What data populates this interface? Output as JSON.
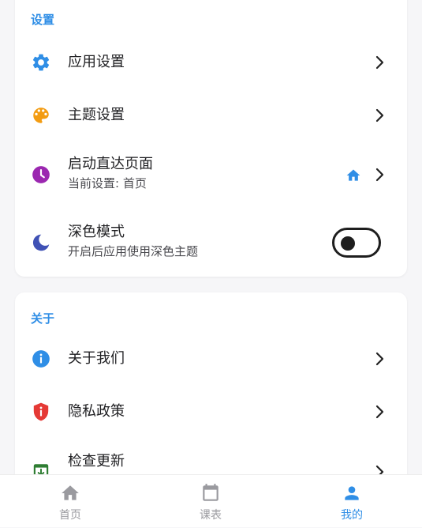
{
  "settings": {
    "section_title": "设置",
    "items": [
      {
        "label": "应用设置",
        "icon": "gear-icon"
      },
      {
        "label": "主题设置",
        "icon": "palette-icon"
      },
      {
        "label": "启动直达页面",
        "sub": "当前设置: 首页",
        "icon": "clock-icon",
        "trailing_icon": "home-icon"
      },
      {
        "label": "深色模式",
        "sub": "开启后应用使用深色主题",
        "icon": "moon-icon",
        "toggle": false
      }
    ]
  },
  "about": {
    "section_title": "关于",
    "items": [
      {
        "label": "关于我们",
        "icon": "info-icon"
      },
      {
        "label": "隐私政策",
        "icon": "shield-icon"
      },
      {
        "label": "检查更新",
        "icon": "update-icon"
      }
    ]
  },
  "bottom_nav": {
    "items": [
      {
        "label": "首页",
        "icon": "home-icon",
        "active": false
      },
      {
        "label": "课表",
        "icon": "calendar-icon",
        "active": false
      },
      {
        "label": "我的",
        "icon": "person-icon",
        "active": true
      }
    ]
  },
  "colors": {
    "accent": "#2f8ee6",
    "gear": "#2f8ee6",
    "palette": "#f39c12",
    "clock": "#9b27b0",
    "moon": "#3f51b5",
    "info": "#2f8ee6",
    "shield": "#e53935",
    "update": "#2e7d32"
  }
}
